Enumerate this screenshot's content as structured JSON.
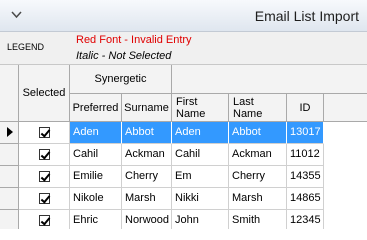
{
  "window": {
    "title": "Email List Import"
  },
  "legend": {
    "title": "LEGEND",
    "red_font": "Red Font - Invalid Entry",
    "italic": "Italic - Not Selected"
  },
  "grid": {
    "group_header": "Synergetic",
    "columns": {
      "selected": "Selected",
      "preferred": "Preferred",
      "surname": "Surname",
      "first_name": "First Name",
      "last_name": "Last Name",
      "id": "ID"
    },
    "rows": [
      {
        "selected": true,
        "preferred": "Aden",
        "surname": "Abbot",
        "first_name": "Aden",
        "last_name": "Abbot",
        "id": "13017"
      },
      {
        "selected": true,
        "preferred": "Cahil",
        "surname": "Ackman",
        "first_name": "Cahil",
        "last_name": "Ackman",
        "id": "11012"
      },
      {
        "selected": true,
        "preferred": "Emilie",
        "surname": "Cherry",
        "first_name": "Em",
        "last_name": "Cherry",
        "id": "14355"
      },
      {
        "selected": true,
        "preferred": "Nikole",
        "surname": "Marsh",
        "first_name": "Nikki",
        "last_name": "Marsh",
        "id": "14865"
      },
      {
        "selected": true,
        "preferred": "Ehric",
        "surname": "Norwood",
        "first_name": "John",
        "last_name": "Smith",
        "id": "12345"
      }
    ],
    "current_row": 0
  },
  "colors": {
    "selection": "#3399ff",
    "invalid": "#e00000"
  }
}
